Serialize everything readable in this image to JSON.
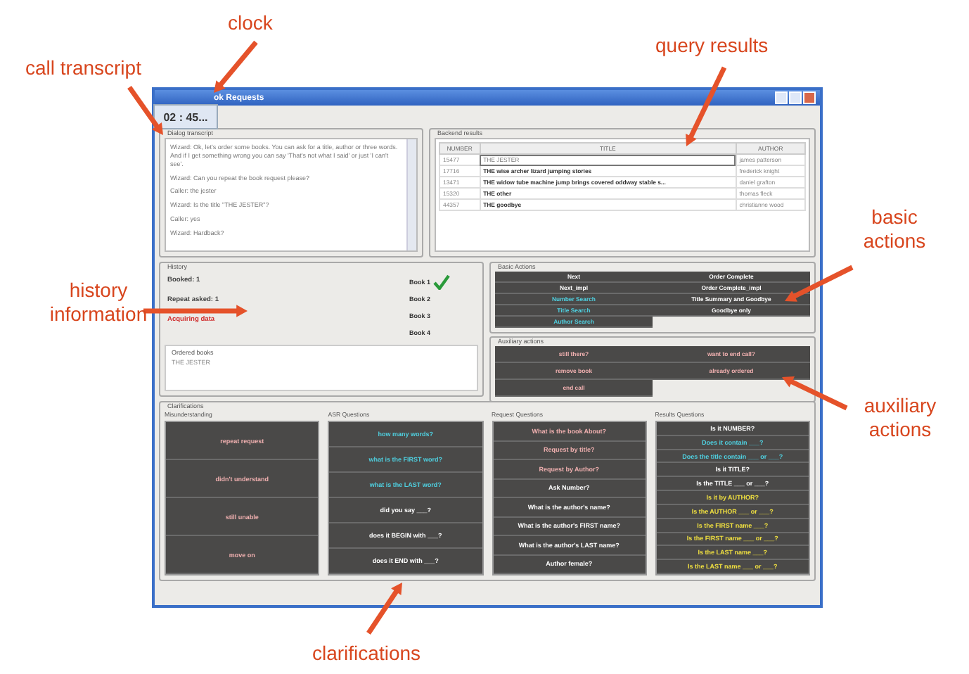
{
  "annotations": [
    {
      "text": "clock"
    },
    {
      "text": "call transcript"
    },
    {
      "text": "query results"
    },
    {
      "text": "basic actions"
    },
    {
      "text": "history information"
    },
    {
      "text": "auxiliary actions"
    },
    {
      "text": "clarifications"
    }
  ],
  "window": {
    "title": "ok Requests"
  },
  "clock": "02 : 45...",
  "transcript": {
    "title": "Dialog transcript",
    "lines": [
      "Wizard: Ok, let's order some books. You can ask for a title, author or three words. And if I get something wrong you can say 'That's not what I said' or just 'I can't see'.",
      "Wizard: Can you repeat the book request please?",
      "Caller: the jester",
      "Wizard: Is the title \"THE JESTER\"?",
      "Caller: yes",
      "Wizard: Hardback?"
    ]
  },
  "results": {
    "title": "Backend results",
    "columns": [
      "NUMBER",
      "TITLE",
      "AUTHOR"
    ],
    "rows": [
      {
        "cells": [
          "15477",
          "THE JESTER",
          "james patterson"
        ],
        "selected": true
      },
      {
        "cells": [
          "17716",
          "THE wise archer lizard jumping stories",
          "frederick knight"
        ],
        "selected": false
      },
      {
        "cells": [
          "13471",
          "THE widow tube machine jump brings covered oddway stable s...",
          "daniel grafton"
        ],
        "selected": false
      },
      {
        "cells": [
          "15320",
          "THE other",
          "thomas fleck"
        ],
        "selected": false
      },
      {
        "cells": [
          "44357",
          "THE goodbye",
          "christianne wood"
        ],
        "selected": false
      }
    ]
  },
  "history": {
    "title": "History",
    "stats": [
      {
        "text": "Booked: 1",
        "kind": "normal"
      },
      {
        "text": "Repeat asked: 1",
        "kind": "normal"
      },
      {
        "text": "Acquiring data",
        "kind": "alert"
      }
    ],
    "books": [
      {
        "label": "Book 1",
        "checked": true
      },
      {
        "label": "Book 2",
        "checked": false
      },
      {
        "label": "Book 3",
        "checked": false
      },
      {
        "label": "Book 4",
        "checked": false
      }
    ],
    "ordered": {
      "title": "Ordered books",
      "items": [
        "THE JESTER"
      ]
    }
  },
  "basic_actions": {
    "title": "Basic Actions",
    "columns": [
      [
        {
          "label": "Next",
          "kind": "plain"
        },
        {
          "label": "Next_impl",
          "kind": "plain"
        },
        {
          "label": "Number Search",
          "kind": "search"
        },
        {
          "label": "Title Search",
          "kind": "search"
        },
        {
          "label": "Author Search",
          "kind": "search"
        }
      ],
      [
        {
          "label": "Order Complete",
          "kind": "plain"
        },
        {
          "label": "Order Complete_impl",
          "kind": "plain"
        },
        {
          "label": "Title Summary and Goodbye",
          "kind": "plain"
        },
        {
          "label": "Goodbye only",
          "kind": "plain"
        }
      ]
    ]
  },
  "auxiliary_actions": {
    "title": "Auxiliary actions",
    "columns": [
      [
        {
          "label": "still there?",
          "kind": "social"
        },
        {
          "label": "remove book",
          "kind": "social"
        },
        {
          "label": "end call",
          "kind": "social"
        }
      ],
      [
        {
          "label": "want to end call?",
          "kind": "social"
        },
        {
          "label": "already ordered",
          "kind": "social"
        }
      ]
    ]
  },
  "clarifications": {
    "title": "Clarifications",
    "groups": [
      {
        "title": "Misunderstanding",
        "buttons": [
          {
            "label": "repeat request",
            "kind": "social"
          },
          {
            "label": "didn't understand",
            "kind": "social"
          },
          {
            "label": "still unable",
            "kind": "social"
          },
          {
            "label": "move on",
            "kind": "social"
          }
        ]
      },
      {
        "title": "ASR Questions",
        "buttons": [
          {
            "label": "how many words?",
            "kind": "search"
          },
          {
            "label": "what is the FIRST word?",
            "kind": "search"
          },
          {
            "label": "what is the LAST word?",
            "kind": "search"
          },
          {
            "label": "did you say ___?",
            "kind": "plain"
          },
          {
            "label": "does it BEGIN with ___?",
            "kind": "plain"
          },
          {
            "label": "does it END with ___?",
            "kind": "plain"
          }
        ]
      },
      {
        "title": "Request Questions",
        "buttons": [
          {
            "label": "What is the book About?",
            "kind": "social"
          },
          {
            "label": "Request by title?",
            "kind": "social"
          },
          {
            "label": "Request by Author?",
            "kind": "social"
          },
          {
            "label": "Ask Number?",
            "kind": "plain"
          },
          {
            "label": "What is the author's name?",
            "kind": "plain"
          },
          {
            "label": "What is the author's FIRST name?",
            "kind": "plain"
          },
          {
            "label": "What is the author's LAST name?",
            "kind": "plain"
          },
          {
            "label": "Author female?",
            "kind": "plain"
          }
        ]
      },
      {
        "title": "Results Questions",
        "buttons": [
          {
            "label": "Is it NUMBER?",
            "kind": "plain"
          },
          {
            "label": "Does it contain ___?",
            "kind": "search"
          },
          {
            "label": "Does the title contain ___ or ___?",
            "kind": "search"
          },
          {
            "label": "Is it TITLE?",
            "kind": "plain"
          },
          {
            "label": "Is the TITLE ___ or ___?",
            "kind": "plain"
          },
          {
            "label": "Is it by AUTHOR?",
            "kind": "author"
          },
          {
            "label": "Is the AUTHOR ___ or ___?",
            "kind": "author"
          },
          {
            "label": "Is the FIRST name ___?",
            "kind": "author"
          },
          {
            "label": "Is the FIRST name ___ or ___?",
            "kind": "author"
          },
          {
            "label": "Is the LAST name ___?",
            "kind": "author"
          },
          {
            "label": "Is the LAST name ___ or ___?",
            "kind": "author"
          }
        ]
      }
    ]
  }
}
